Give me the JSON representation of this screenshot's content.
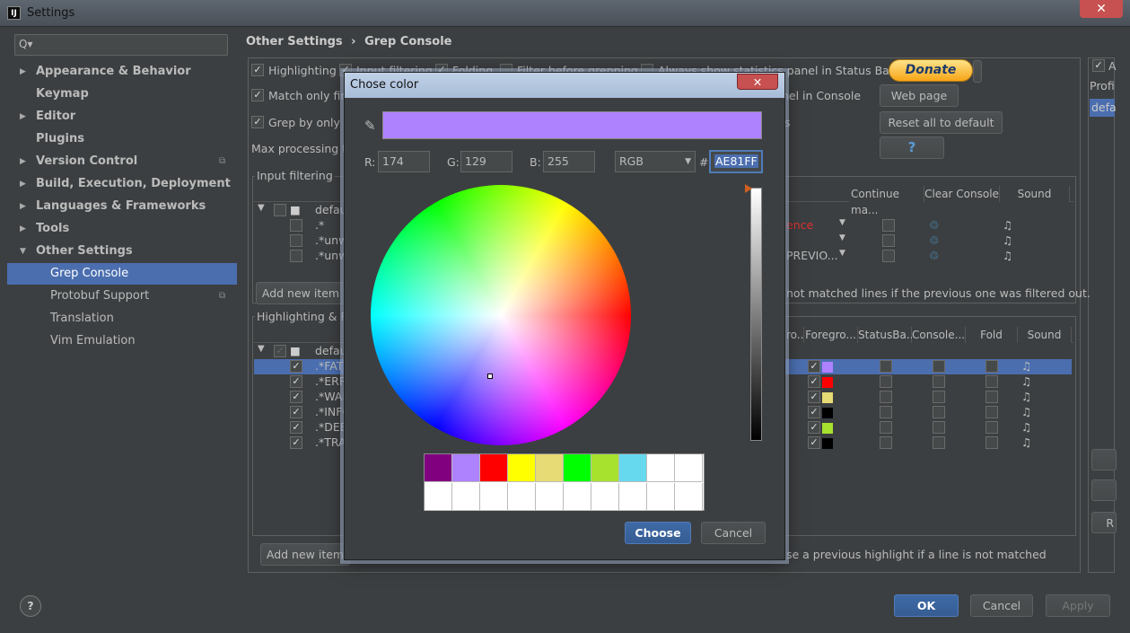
{
  "window": {
    "title": "Settings",
    "icon_text": "IJ"
  },
  "sidebar": {
    "search_placeholder": "Q▾",
    "items": [
      {
        "label": "Appearance & Behavior",
        "bold": true,
        "arrow": true
      },
      {
        "label": "Keymap",
        "bold": true,
        "arrow": false
      },
      {
        "label": "Editor",
        "bold": true,
        "arrow": true
      },
      {
        "label": "Plugins",
        "bold": true,
        "arrow": false
      },
      {
        "label": "Version Control",
        "bold": true,
        "arrow": true,
        "proj": true
      },
      {
        "label": "Build, Execution, Deployment",
        "bold": true,
        "arrow": true
      },
      {
        "label": "Languages & Frameworks",
        "bold": true,
        "arrow": true
      },
      {
        "label": "Tools",
        "bold": true,
        "arrow": true
      },
      {
        "label": "Other Settings",
        "bold": true,
        "arrow": "open"
      },
      {
        "label": "Grep Console",
        "child": true,
        "selected": true
      },
      {
        "label": "Protobuf Support",
        "child": true,
        "proj": true
      },
      {
        "label": "Translation",
        "child": true
      },
      {
        "label": "Vim Emulation",
        "child": true
      }
    ]
  },
  "breadcrumb": {
    "parent": "Other Settings",
    "sep": "›",
    "current": "Grep Console"
  },
  "options": {
    "highlighting": "Highlighting",
    "input_filtering": "Input filtering",
    "folding": "Folding",
    "filter_before": "Filter before grepping",
    "always_show": "Always show statistics panel in Status Bar",
    "match_only": "Match only fir",
    "match_tail": "nel in Console",
    "grep_only": "Grep by only f",
    "grep_tail": "s",
    "max_processing": "Max processing t"
  },
  "buttons": {
    "donate": "Donate",
    "web_page": "Web page",
    "reset": "Reset all to default",
    "help": "?",
    "add_new_item_1": "Add new item",
    "add_new_item_2": "Add new item",
    "ok": "OK",
    "cancel": "Cancel",
    "apply": "Apply",
    "help_round": "?"
  },
  "input_filtering": {
    "title": "Input filtering",
    "headers": [
      "Continue ma...",
      "Clear Console",
      "Sound"
    ],
    "rows": [
      {
        "text": "defau",
        "checked": false
      },
      {
        "text": ".*",
        "checked": false,
        "right": "ence"
      },
      {
        "text": ".*unw",
        "checked": false
      },
      {
        "text": ".*unw",
        "checked": false,
        "right": "PREVIO..."
      }
    ],
    "footer_note": "not matched lines if the previous one was filtered out."
  },
  "highlighting": {
    "title": "Highlighting & Fo",
    "headers": [
      "ro...",
      "Foregro...",
      "StatusBa...",
      "Console...",
      "Fold",
      "Sound"
    ],
    "rows": [
      {
        "text": "defau",
        "checked": true,
        "color": ""
      },
      {
        "text": ".*FAT",
        "checked": true,
        "color": "#ae81ff"
      },
      {
        "text": ".*ERR",
        "checked": true,
        "color": "#ff0000"
      },
      {
        "text": ".*WAR",
        "checked": true,
        "color": "#e6db74"
      },
      {
        "text": ".*INFO",
        "checked": true,
        "color": "#000000"
      },
      {
        "text": ".*DEB",
        "checked": true,
        "color": "#a6e22e"
      },
      {
        "text": ".*TRA",
        "checked": true,
        "color": "#000000"
      }
    ],
    "footer_note": "se a previous highlight if a line is not matched"
  },
  "right_edge": {
    "profiles": "Profi",
    "default": "defa",
    "letter_a": "A",
    "letter_r": "R"
  },
  "dialog": {
    "title": "Chose color",
    "close": "✕",
    "preview_color": "#ae81ff",
    "r_label": "R:",
    "r_value": "174",
    "g_label": "G:",
    "g_value": "129",
    "b_label": "B:",
    "b_value": "255",
    "mode": "RGB",
    "hash": "#",
    "hex": "AE81FF",
    "recent": [
      "#800080",
      "#ae81ff",
      "#ff0000",
      "#ffff00",
      "#e6db74",
      "#00ff00",
      "#a6e22e",
      "#66d9ef",
      "#ffffff",
      "#ffffff"
    ],
    "choose": "Choose",
    "cancel": "Cancel"
  }
}
